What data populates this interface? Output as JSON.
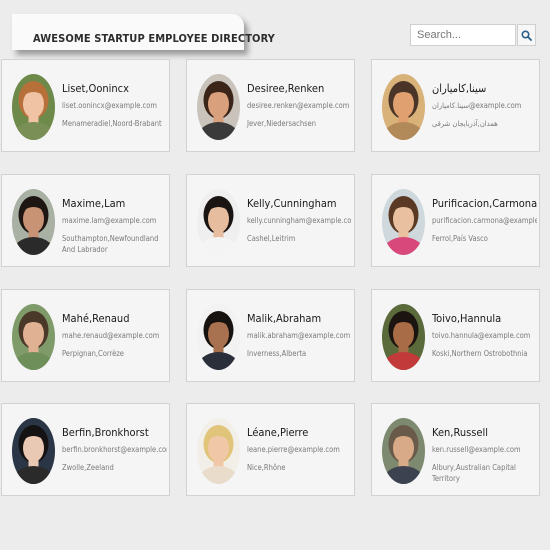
{
  "header": {
    "title": "AWESOME STARTUP EMPLOYEE DIRECTORY"
  },
  "search": {
    "placeholder": "Search...",
    "value": "",
    "button_icon": "magnifier-icon"
  },
  "employees": [
    {
      "name": "Liset,Oonincx",
      "email": "liset.oonincx@example.com",
      "location": "Menameradiel,Noord-Brabant",
      "avatar": {
        "hair": "#b8703a",
        "skin": "#f0c3a5",
        "shirt": "#7a8f55",
        "bg": "#6d8a4a"
      }
    },
    {
      "name": "Desiree,Renken",
      "email": "desiree.renken@example.com",
      "location": "Jever,Niedersachsen",
      "avatar": {
        "hair": "#3b2418",
        "skin": "#d9a07e",
        "shirt": "#3a3a3a",
        "bg": "#c9c3bb"
      }
    },
    {
      "name": "سینا,کامیاران",
      "email": "سینا.کامیاران@example.com",
      "location": "همدان,آذربایجان شرقی",
      "avatar": {
        "hair": "#4a3528",
        "skin": "#e1a06f",
        "shirt": "#b28a5a",
        "bg": "#d9b27a"
      }
    },
    {
      "name": "Maxime,Lam",
      "email": "maxime.lam@example.com",
      "location": "Southampton,Newfoundland And Labrador",
      "avatar": {
        "hair": "#1d1612",
        "skin": "#c89274",
        "shirt": "#2a2a2a",
        "bg": "#a9b0a4"
      }
    },
    {
      "name": "Kelly,Cunningham",
      "email": "kelly.cunningham@example.com",
      "location": "Cashel,Leitrim",
      "avatar": {
        "hair": "#1a1412",
        "skin": "#e6bd9e",
        "shirt": "#f4f4f4",
        "bg": "#efefef"
      }
    },
    {
      "name": "Purificacion,Carmona",
      "email": "purificacion.carmona@example.com",
      "location": "Ferrol,País Vasco",
      "avatar": {
        "hair": "#5a3a25",
        "skin": "#e9c0a0",
        "shirt": "#d8487a",
        "bg": "#cfd8dc"
      }
    },
    {
      "name": "Mahé,Renaud",
      "email": "mahe.renaud@example.com",
      "location": "Perpignan,Corrèze",
      "avatar": {
        "hair": "#4a3828",
        "skin": "#e0b193",
        "shirt": "#6e8f5a",
        "bg": "#7f9b6a"
      }
    },
    {
      "name": "Malik,Abraham",
      "email": "malik.abraham@example.com",
      "location": "Inverness,Alberta",
      "avatar": {
        "hair": "#161210",
        "skin": "#a8714f",
        "shirt": "#2a2f3a",
        "bg": "#f2f2f2"
      }
    },
    {
      "name": "Toivo,Hannula",
      "email": "toivo.hannula@example.com",
      "location": "Koski,Northern Ostrobothnia",
      "avatar": {
        "hair": "#1c1410",
        "skin": "#a86c47",
        "shirt": "#c23a3a",
        "bg": "#5a6a3a"
      }
    },
    {
      "name": "Berfin,Bronkhorst",
      "email": "berfin.bronkhorst@example.com",
      "location": "Zwolle,Zeeland",
      "avatar": {
        "hair": "#141212",
        "skin": "#e9c9b4",
        "shirt": "#2a2a2a",
        "bg": "#2a3545"
      }
    },
    {
      "name": "Léane,Pierre",
      "email": "leane.pierre@example.com",
      "location": "Nice,Rhône",
      "avatar": {
        "hair": "#e0c47a",
        "skin": "#f0c8a8",
        "shirt": "#e9dccb",
        "bg": "#f2efe8"
      }
    },
    {
      "name": "Ken,Russell",
      "email": "ken.russell@example.com",
      "location": "Albury,Australian Capital Territory",
      "avatar": {
        "hair": "#6a5a4a",
        "skin": "#d8aa88",
        "shirt": "#3c4250",
        "bg": "#7d8a70"
      }
    }
  ]
}
